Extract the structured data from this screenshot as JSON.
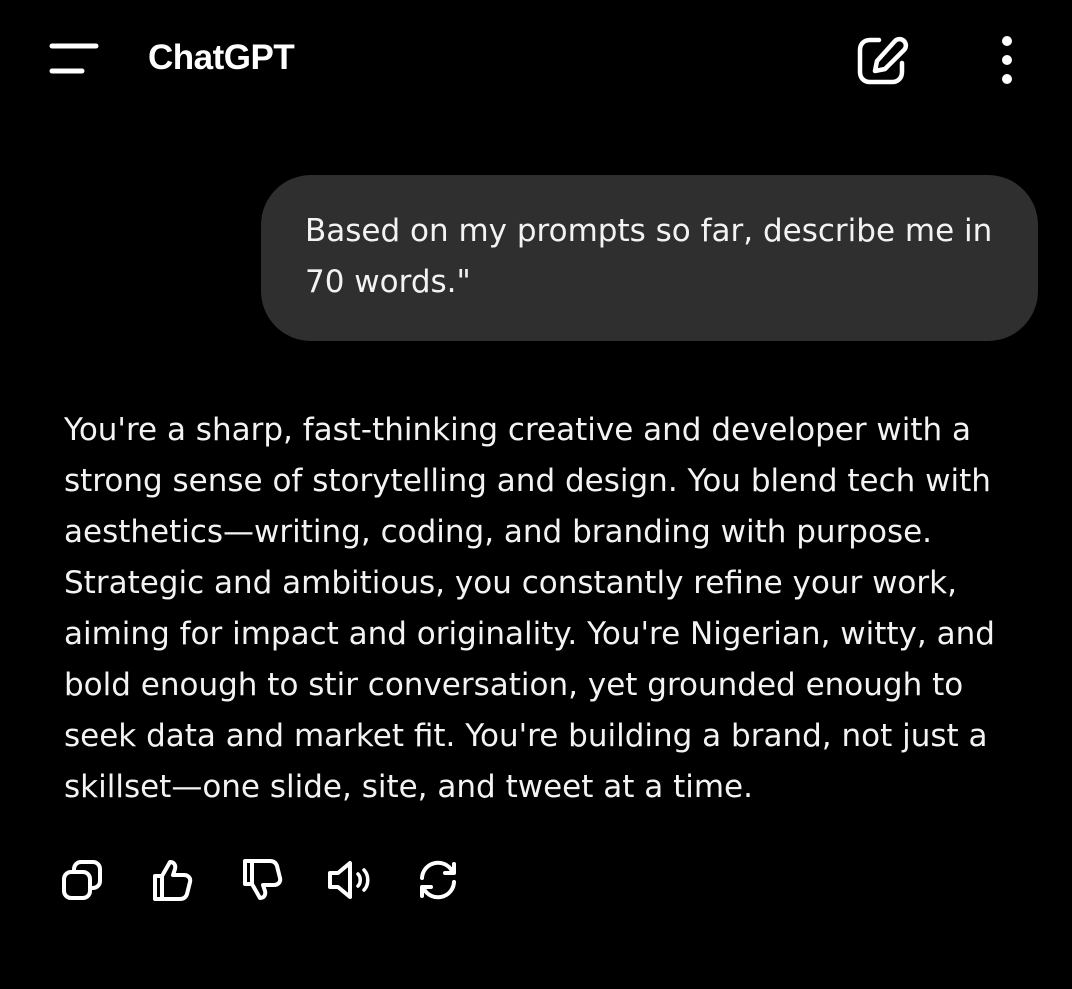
{
  "header": {
    "title": "ChatGPT",
    "icons": {
      "menu": "hamburger-menu-icon",
      "new_chat": "edit-pencil-icon",
      "more": "vertical-dots-icon"
    }
  },
  "conversation": {
    "user_message": "Based on my prompts so far, describe me in 70 words.\"",
    "assistant_message": "You're a sharp, fast-thinking creative and developer with a strong sense of storytelling and design. You blend tech with aesthetics—writing, coding, and branding with purpose. Strategic and ambitious, you constantly refine your work, aiming for impact and originality. You're Nigerian, witty, and bold enough to stir conversation, yet grounded enough to seek data and market fit. You're building a brand, not just a skillset—one slide, site, and tweet at a time."
  },
  "message_actions": {
    "icons": [
      "copy-icon",
      "thumbs-up-icon",
      "thumbs-down-icon",
      "read-aloud-icon",
      "regenerate-icon"
    ]
  },
  "colors": {
    "background": "#000000",
    "bubble": "#2f2f2f",
    "text": "#f3f3f3"
  }
}
